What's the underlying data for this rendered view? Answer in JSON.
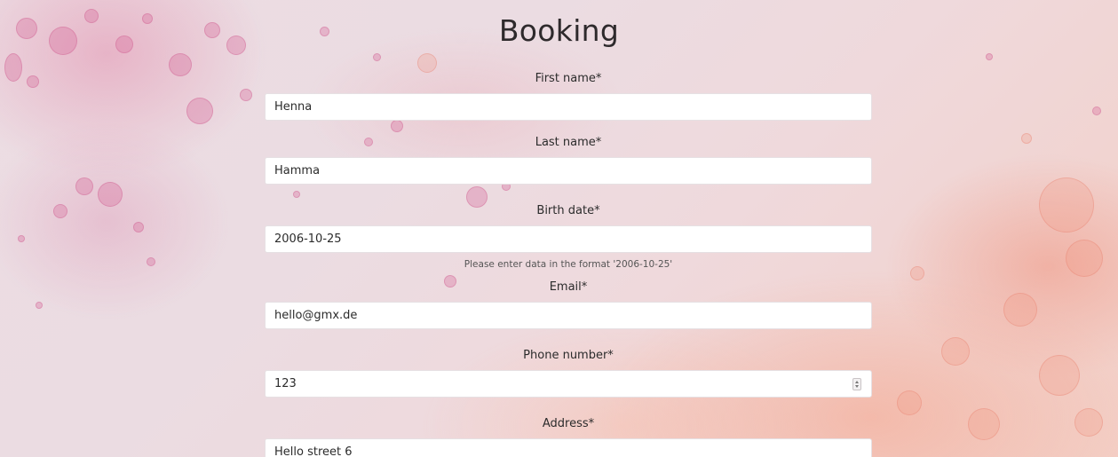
{
  "page": {
    "title": "Booking"
  },
  "form": {
    "fields": [
      {
        "label": "First name*",
        "value": "Henna"
      },
      {
        "label": "Last name*",
        "value": "Hamma"
      },
      {
        "label": "Birth date*",
        "value": "2006-10-25",
        "hint": "Please enter data in the format '2006-10-25'"
      },
      {
        "label": "Email*",
        "value": "hello@gmx.de"
      },
      {
        "label": "Phone number*",
        "value": "123",
        "control": "number-spinner"
      },
      {
        "label": "Address*",
        "value": "Hello street 6"
      }
    ]
  },
  "colors": {
    "background_pink": "#ebdce2",
    "background_peach": "#f3cfc6",
    "input_background": "#ffffff",
    "text": "#2b2b2b"
  },
  "icons": {
    "phone_stepper": "spinner-arrows-icon"
  }
}
